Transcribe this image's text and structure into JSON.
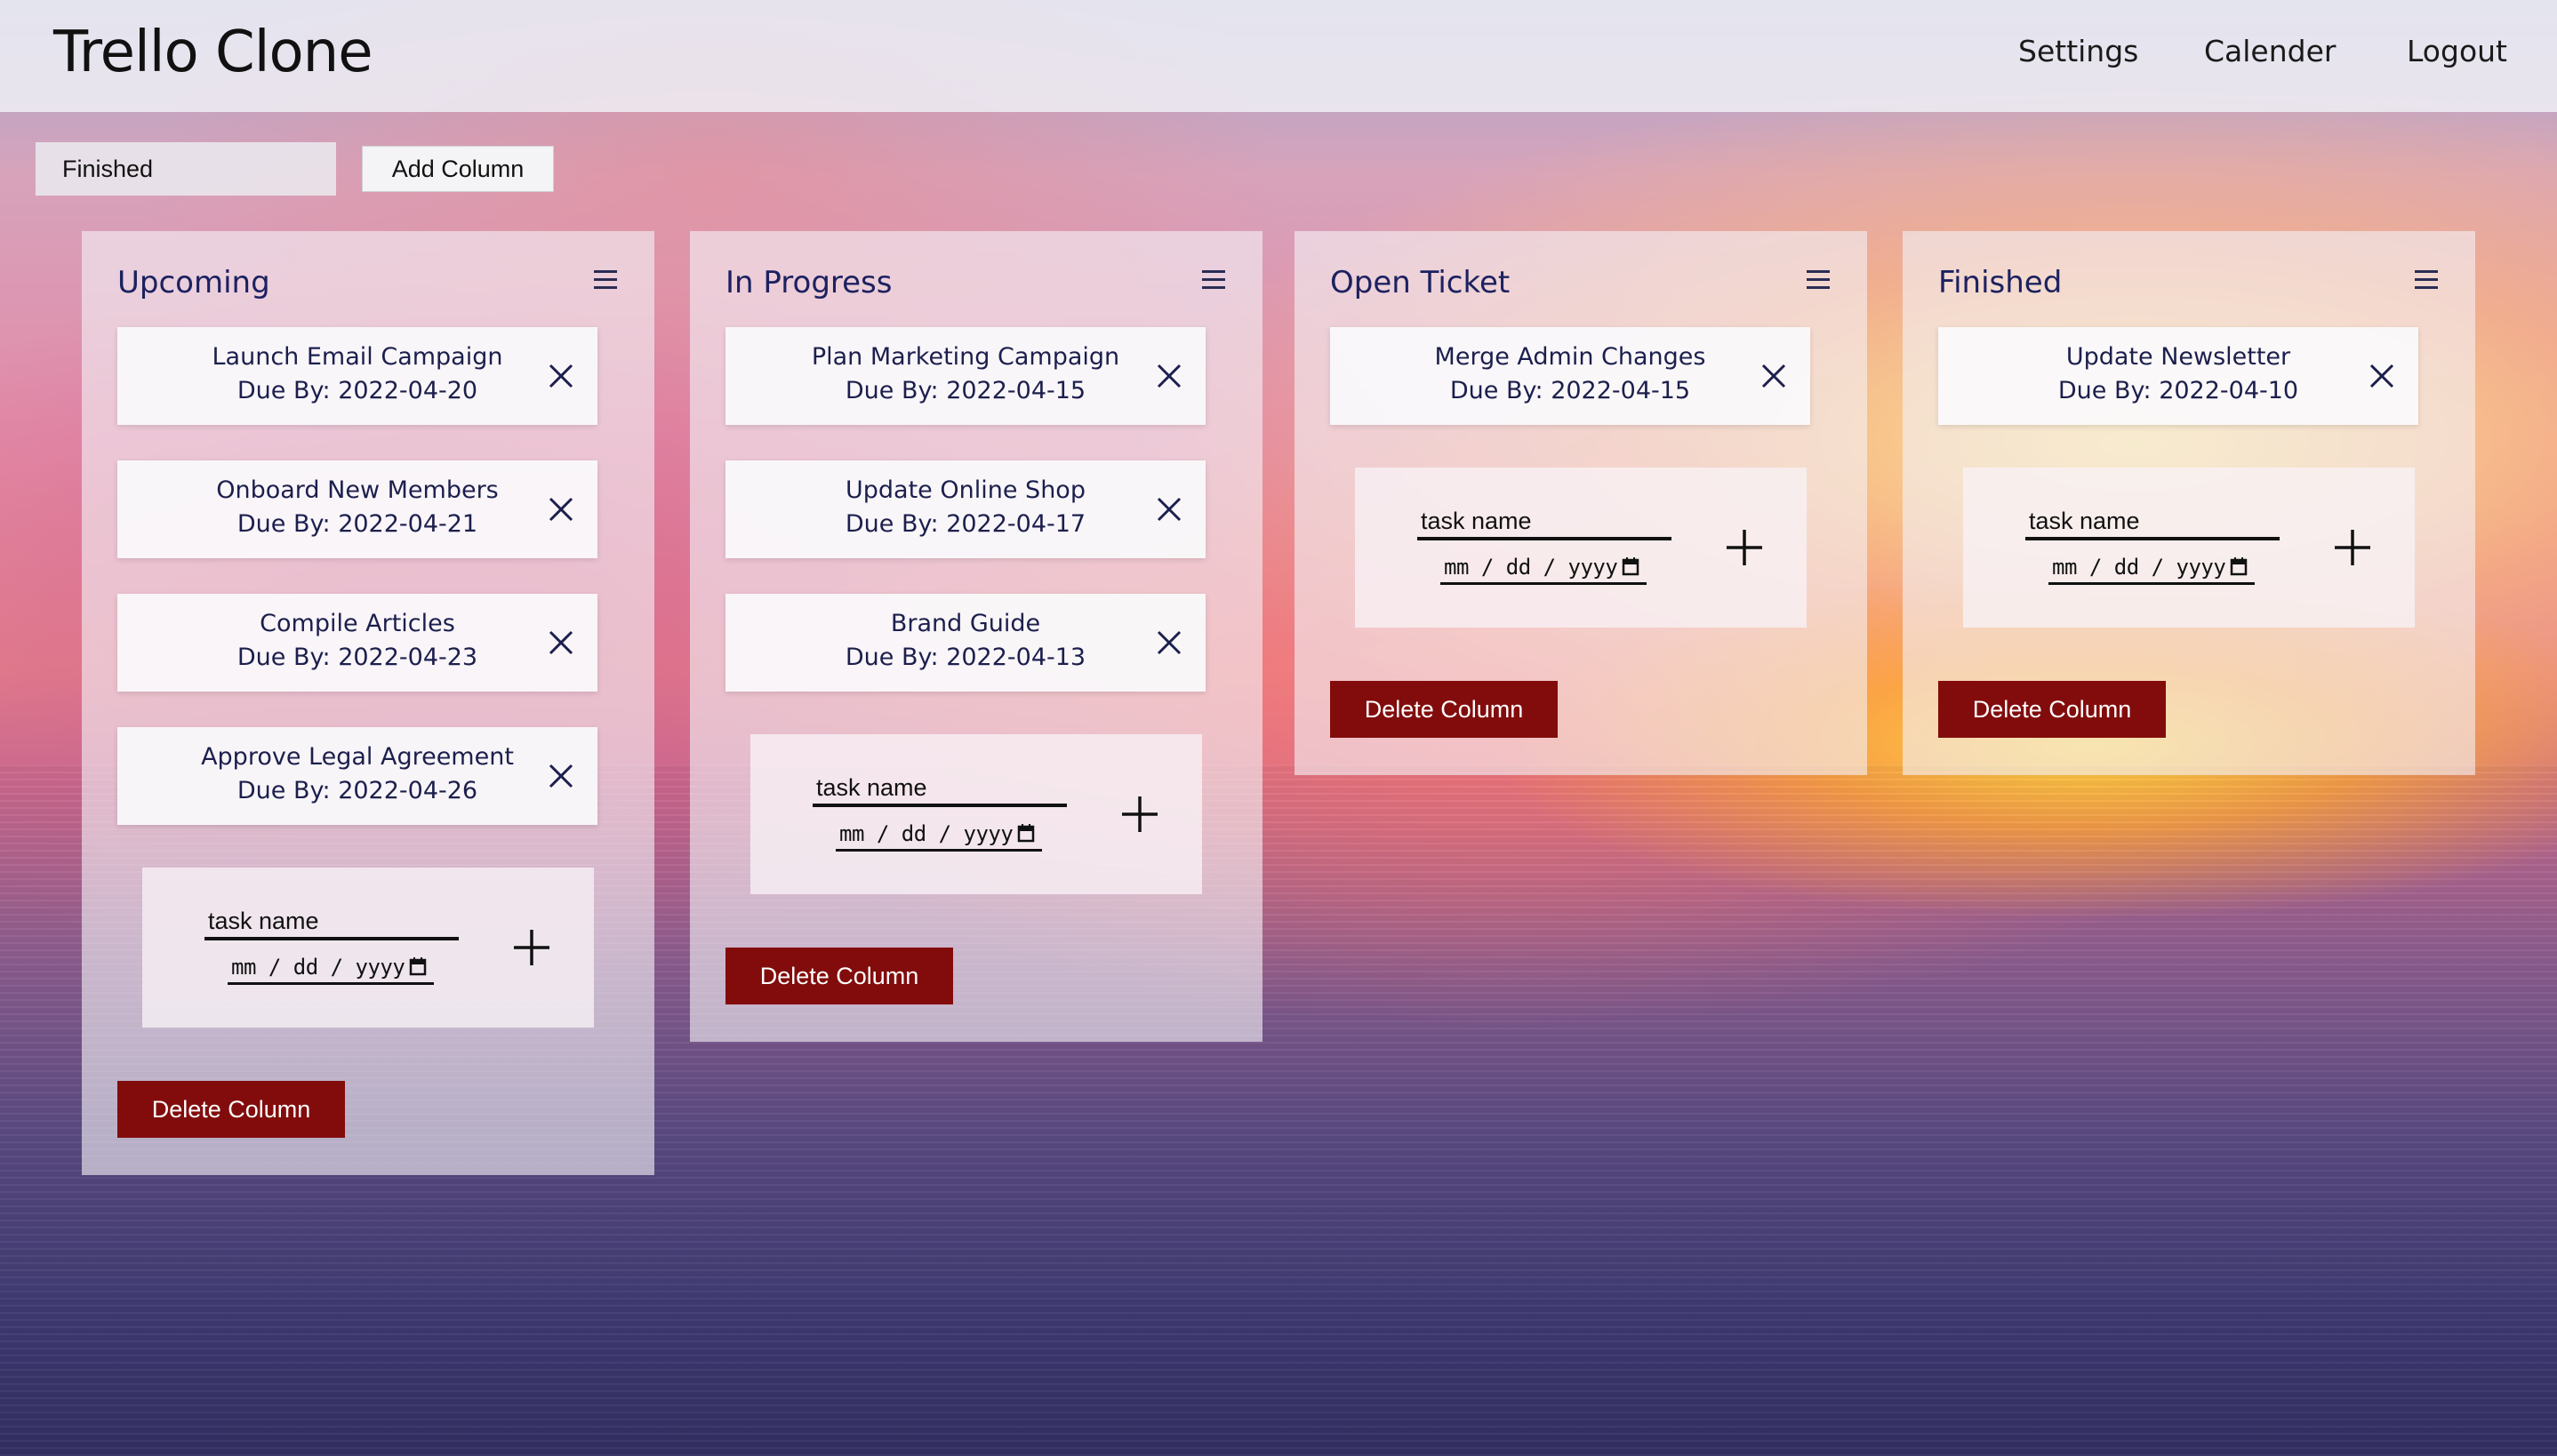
{
  "navbar": {
    "brand": "Trello Clone",
    "links": [
      "Settings",
      "Calender",
      "Logout"
    ]
  },
  "toolbar": {
    "column_name_value": "Finished",
    "add_column_label": "Add Column"
  },
  "new_task_form": {
    "task_name_placeholder": "task name",
    "date_placeholder": "mm / dd / yyyy"
  },
  "delete_column_label": "Delete Column",
  "columns": [
    {
      "title": "Upcoming",
      "tasks": [
        {
          "name": "Launch Email Campaign",
          "due": "Due By: 2022-04-20"
        },
        {
          "name": "Onboard New Members",
          "due": "Due By: 2022-04-21"
        },
        {
          "name": "Compile Articles",
          "due": "Due By: 2022-04-23"
        },
        {
          "name": "Approve Legal Agreement",
          "due": "Due By: 2022-04-26"
        }
      ]
    },
    {
      "title": "In Progress",
      "tasks": [
        {
          "name": "Plan Marketing Campaign",
          "due": "Due By: 2022-04-15"
        },
        {
          "name": "Update Online Shop",
          "due": "Due By: 2022-04-17"
        },
        {
          "name": "Brand Guide",
          "due": "Due By: 2022-04-13"
        }
      ]
    },
    {
      "title": "Open Ticket",
      "tasks": [
        {
          "name": "Merge Admin Changes",
          "due": "Due By: 2022-04-15"
        }
      ]
    },
    {
      "title": "Finished",
      "tasks": [
        {
          "name": "Update Newsletter",
          "due": "Due By: 2022-04-10"
        }
      ]
    }
  ],
  "colors": {
    "delete_button": "#820c0c",
    "column_title": "#1c2160"
  }
}
